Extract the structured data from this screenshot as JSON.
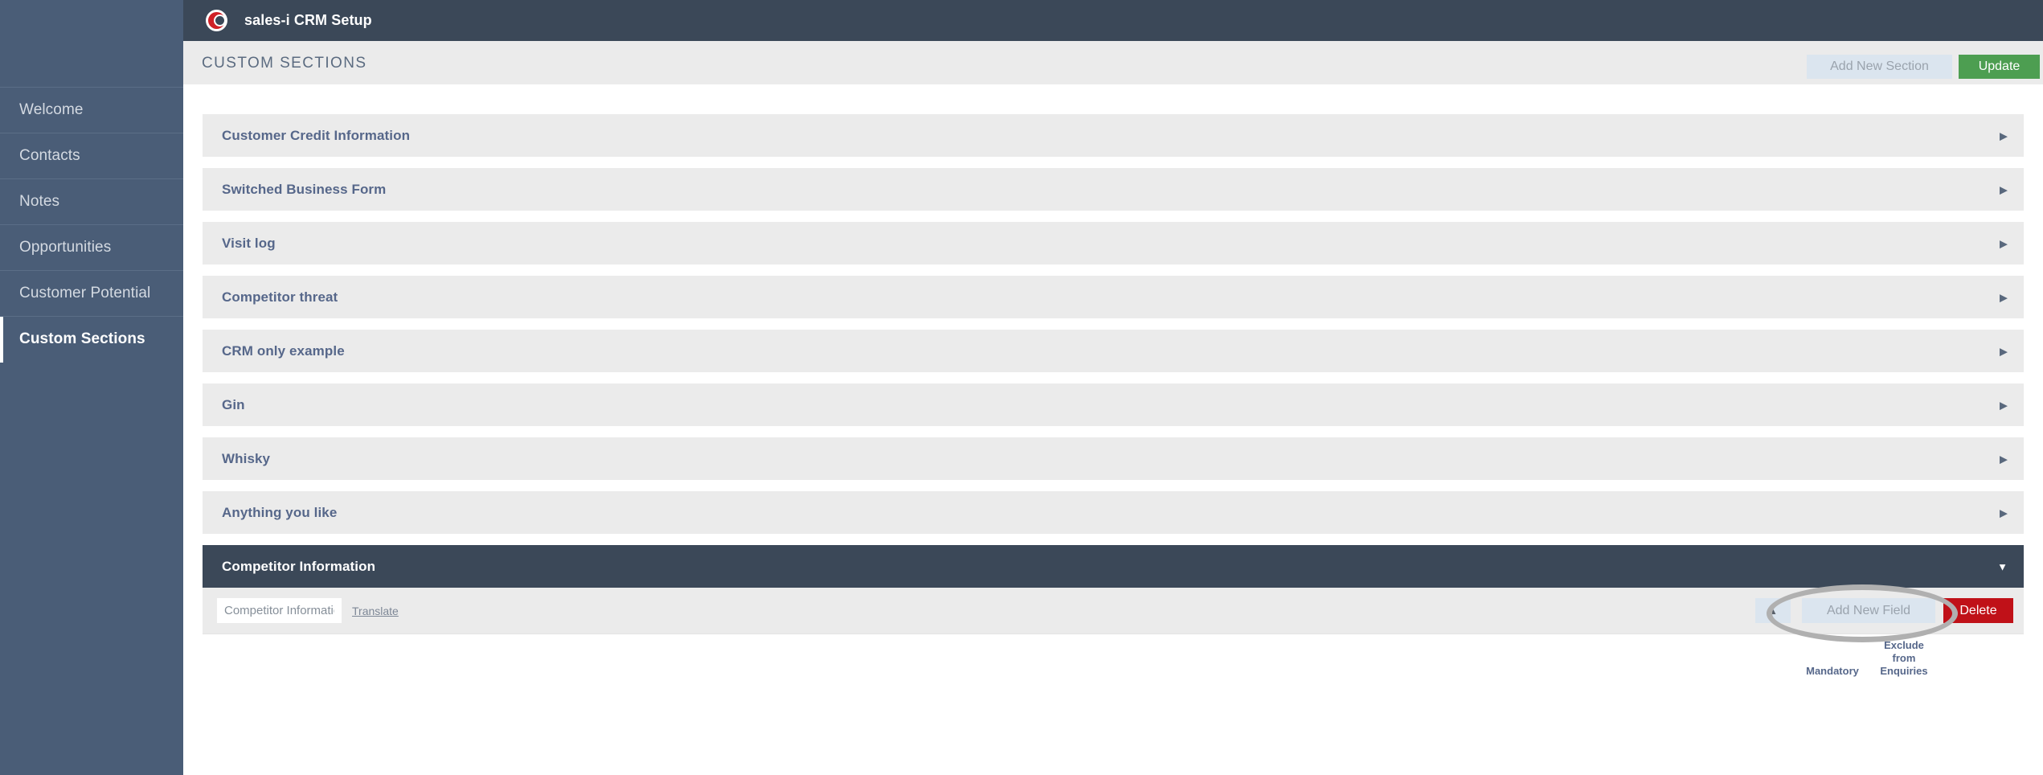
{
  "app": {
    "title": "sales-i CRM Setup",
    "logo_icon": "sales-i-logo-icon"
  },
  "sidebar": {
    "items": [
      {
        "label": "Welcome",
        "active": false
      },
      {
        "label": "Contacts",
        "active": false
      },
      {
        "label": "Notes",
        "active": false
      },
      {
        "label": "Opportunities",
        "active": false
      },
      {
        "label": "Customer Potential",
        "active": false
      },
      {
        "label": "Custom Sections",
        "active": true
      }
    ]
  },
  "page": {
    "title": "CUSTOM SECTIONS",
    "add_new_section_label": "Add New Section",
    "update_label": "Update"
  },
  "sections": [
    {
      "label": "Customer Credit Information",
      "expanded": false,
      "chevron": "▶"
    },
    {
      "label": "Switched Business Form",
      "expanded": false,
      "chevron": "▶"
    },
    {
      "label": "Visit log",
      "expanded": false,
      "chevron": "▶"
    },
    {
      "label": "Competitor threat",
      "expanded": false,
      "chevron": "▶"
    },
    {
      "label": "CRM only example",
      "expanded": false,
      "chevron": "▶"
    },
    {
      "label": "Gin",
      "expanded": false,
      "chevron": "▶"
    },
    {
      "label": "Whisky",
      "expanded": false,
      "chevron": "▶"
    },
    {
      "label": "Anything you like",
      "expanded": false,
      "chevron": "▶"
    },
    {
      "label": "Competitor Information",
      "expanded": true,
      "chevron": "▼"
    }
  ],
  "expanded_section": {
    "name_value": "Competitor Information",
    "name_placeholder": "Competitor Information",
    "translate_label": "Translate",
    "collapse_icon": "▲",
    "add_new_field_label": "Add New Field",
    "delete_label": "Delete",
    "column_headers": {
      "mandatory": "Mandatory",
      "exclude_from_enquiries": "Exclude from Enquiries"
    }
  },
  "colors": {
    "sidebar_bg": "#4a5d75",
    "topbar_bg": "#3b4858",
    "header_bg": "#ebebeb",
    "section_bg": "#ebebeb",
    "section_label": "#56678a",
    "update_green": "#4d9e51",
    "delete_red": "#c01118",
    "button_light_blue": "#dbe5ef",
    "annotation_gray": "#b0b0b0"
  }
}
